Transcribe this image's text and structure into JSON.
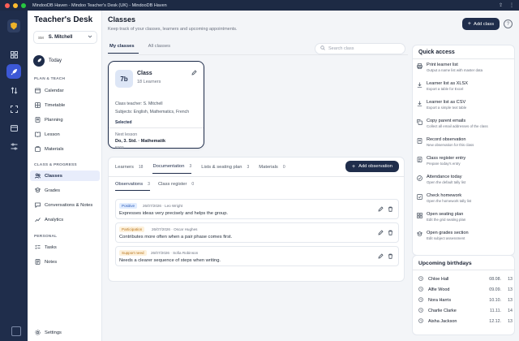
{
  "window": {
    "title": "MindooDB Haven - Mindoo Teacher's Desk (UK) - MindooDB Haven"
  },
  "sidebar": {
    "app_title": "Teacher's Desk",
    "user": {
      "initials": "SM",
      "name": "S. Mitchell"
    },
    "today_label": "Today",
    "sections": {
      "plan_teach": "PLAN & TEACH",
      "class_progress": "CLASS & PROGRESS",
      "personal": "PERSONAL"
    },
    "items": [
      {
        "label": "Calendar",
        "icon": "calendar-icon"
      },
      {
        "label": "Timetable",
        "icon": "timetable-icon"
      },
      {
        "label": "Planning",
        "icon": "planning-icon"
      },
      {
        "label": "Lesson",
        "icon": "lesson-icon"
      },
      {
        "label": "Materials",
        "icon": "materials-icon"
      },
      {
        "label": "Classes",
        "icon": "classes-icon",
        "active": true
      },
      {
        "label": "Grades",
        "icon": "grades-icon"
      },
      {
        "label": "Conversations & Notes",
        "icon": "conversations-icon"
      },
      {
        "label": "Analytics",
        "icon": "analytics-icon"
      },
      {
        "label": "Tasks",
        "icon": "tasks-icon"
      },
      {
        "label": "Notes",
        "icon": "notes-icon"
      }
    ],
    "settings_label": "Settings"
  },
  "main": {
    "title": "Classes",
    "subtitle": "Keep track of your classes, learners and upcoming appointments.",
    "tabs": [
      {
        "label": "My classes",
        "active": true
      },
      {
        "label": "All classes"
      }
    ],
    "search_placeholder": "Search class"
  },
  "class_card": {
    "badge": "7b",
    "name": "Class",
    "learners": "18 Learners",
    "teacher": "Class teacher: S. Mitchell",
    "subjects": "Subjects: English, Mathematics, French",
    "status": "Selected",
    "next_lesson_label": "Next lesson",
    "next_lesson_value": "Do, 3. Std. · Mathematik",
    "room": "B203"
  },
  "detail": {
    "tabs": [
      {
        "label": "Learners",
        "count": "18"
      },
      {
        "label": "Documentation",
        "count": "3",
        "active": true
      },
      {
        "label": "Lists & seating plan",
        "count": "3"
      },
      {
        "label": "Materials",
        "count": "0"
      }
    ],
    "add_button": "Add observation",
    "subtabs": [
      {
        "label": "Observations",
        "count": "3",
        "active": true
      },
      {
        "label": "Class register",
        "count": "0"
      }
    ],
    "observations": [
      {
        "tag": "Positive",
        "tag_bg": "#e0ecff",
        "tag_color": "#2b5bb8",
        "meta": "26/07/2026 · Leo Wright",
        "text": "Expresses ideas very precisely and helps the group."
      },
      {
        "tag": "Participation",
        "tag_bg": "#fdf1dc",
        "tag_color": "#b8741a",
        "meta": "26/07/2026 · Oscar Hughes",
        "text": "Contributes more often when a pair phase comes first."
      },
      {
        "tag": "Support need",
        "tag_bg": "#fdf1dc",
        "tag_color": "#b8741a",
        "meta": "26/07/2026 · Sofia Robinson",
        "text": "Needs a clearer sequence of steps when writing."
      }
    ]
  },
  "right": {
    "add_class": "Add class",
    "help": "?",
    "quick_access_title": "Quick access",
    "quick_access": [
      {
        "title": "Print learner list",
        "desc": "Output a name list with master data",
        "icon": "print-icon"
      },
      {
        "title": "Learner list as XLSX",
        "desc": "Export a table for Excel",
        "icon": "download-icon"
      },
      {
        "title": "Learner list as CSV",
        "desc": "Export a simple text table",
        "icon": "download-icon"
      },
      {
        "title": "Copy parent emails",
        "desc": "Collect all email addresses of the class",
        "icon": "copy-icon"
      },
      {
        "title": "Record observation",
        "desc": "New observation for this class",
        "icon": "record-icon"
      },
      {
        "title": "Class register entry",
        "desc": "Prepare today's entry",
        "icon": "register-icon"
      },
      {
        "title": "Attendance today",
        "desc": "Open the default tally list",
        "icon": "attendance-icon"
      },
      {
        "title": "Check homework",
        "desc": "Open the homework tally list",
        "icon": "homework-icon"
      },
      {
        "title": "Open seating plan",
        "desc": "Edit the grid seating plan",
        "icon": "seating-icon"
      },
      {
        "title": "Open grades section",
        "desc": "Edit subject assessment",
        "icon": "grades-icon"
      }
    ],
    "birthdays_title": "Upcoming birthdays",
    "birthdays": [
      {
        "name": "Chloe Hall",
        "date": "08.08.",
        "age": "13"
      },
      {
        "name": "Alfie Wood",
        "date": "09.09.",
        "age": "13"
      },
      {
        "name": "Nora Harris",
        "date": "10.10.",
        "age": "13"
      },
      {
        "name": "Charlie Clarke",
        "date": "11.11.",
        "age": "14"
      },
      {
        "name": "Aisha Jackson",
        "date": "12.12.",
        "age": "13"
      }
    ]
  }
}
